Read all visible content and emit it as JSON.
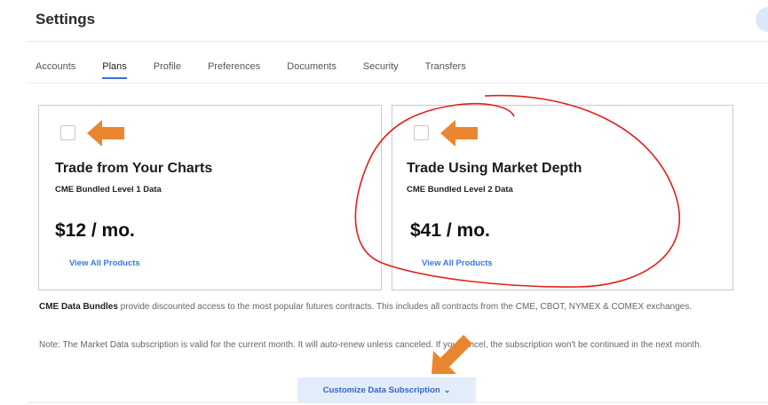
{
  "page": {
    "title": "Settings"
  },
  "tabs": [
    {
      "label": "Accounts",
      "active": false
    },
    {
      "label": "Plans",
      "active": true
    },
    {
      "label": "Profile",
      "active": false
    },
    {
      "label": "Preferences",
      "active": false
    },
    {
      "label": "Documents",
      "active": false
    },
    {
      "label": "Security",
      "active": false
    },
    {
      "label": "Transfers",
      "active": false
    }
  ],
  "plans": [
    {
      "title": "Trade from Your Charts",
      "subtitle": "CME Bundled Level 1 Data",
      "price": "$12 / mo.",
      "link": "View All Products",
      "checked": false
    },
    {
      "title": "Trade Using Market Depth",
      "subtitle": "CME Bundled Level 2 Data",
      "price": "$41 / mo.",
      "link": "View All Products",
      "checked": false
    }
  ],
  "description": {
    "bold": "CME Data Bundles",
    "text": " provide discounted access to the most popular futures contracts. This includes all contracts from the CME, CBOT, NYMEX & COMEX exchanges."
  },
  "note": "Note: The Market Data subscription is valid for the current month. It will auto-renew unless canceled. If you cancel, the subscription won't be continued in the next month.",
  "customize_button": {
    "label": "Customize Data Subscription",
    "icon": "chevron-down-icon"
  },
  "annotations": {
    "arrow_color": "#ea8630",
    "circle_color": "#e0211b"
  },
  "colors": {
    "accent": "#3b6fd6",
    "link": "#3a78e0",
    "button_bg": "#e3ecfb"
  }
}
